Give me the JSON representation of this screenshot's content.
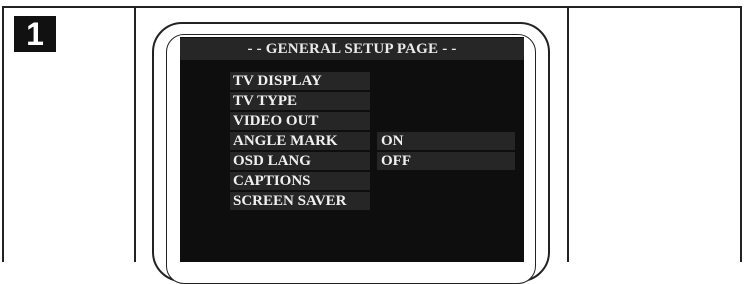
{
  "step": {
    "number": "1"
  },
  "osd": {
    "title": "- - GENERAL SETUP PAGE - -",
    "menu_items": [
      "TV DISPLAY",
      "TV TYPE",
      "VIDEO OUT",
      "ANGLE MARK",
      "OSD LANG",
      "CAPTIONS",
      "SCREEN SAVER"
    ],
    "options": [
      "ON",
      "OFF"
    ]
  },
  "colors": {
    "screen_background": "#0e0e0e",
    "item_background": "#262626",
    "text": "#f0f0f0"
  }
}
